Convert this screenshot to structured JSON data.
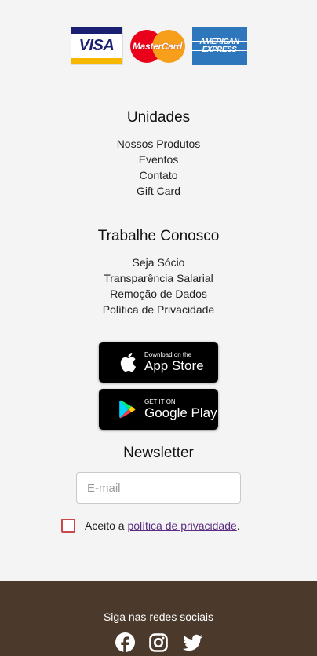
{
  "payment_cards": [
    {
      "name": "visa-logo",
      "label": "VISA"
    },
    {
      "name": "mastercard-logo",
      "label": "MasterCard"
    },
    {
      "name": "amex-logo",
      "label_top": "AMERICAN",
      "label_bottom": "EXPRESS"
    }
  ],
  "unidades": {
    "title": "Unidades",
    "links": [
      "Nossos Produtos",
      "Eventos",
      "Contato",
      "Gift Card"
    ]
  },
  "trabalhe": {
    "title": "Trabalhe Conosco",
    "links": [
      "Seja Sócio",
      "Transparência Salarial",
      "Remoção de Dados",
      "Política de Privacidade"
    ]
  },
  "stores": {
    "app_store": {
      "small": "Download on the",
      "big": "App Store"
    },
    "google_play": {
      "small": "GET IT ON",
      "big": "Google Play"
    }
  },
  "newsletter": {
    "title": "Newsletter",
    "email_placeholder": "E-mail",
    "consent_prefix": "Aceito a ",
    "consent_link": "política de privacidade",
    "consent_suffix": "."
  },
  "footer": {
    "social_title": "Siga nas redes sociais",
    "icons": [
      "facebook-icon",
      "instagram-icon",
      "twitter-icon"
    ]
  },
  "colors": {
    "footer_bg": "#4b3a2b",
    "checkbox_border": "#c9494b",
    "link": "#5a2d82"
  }
}
